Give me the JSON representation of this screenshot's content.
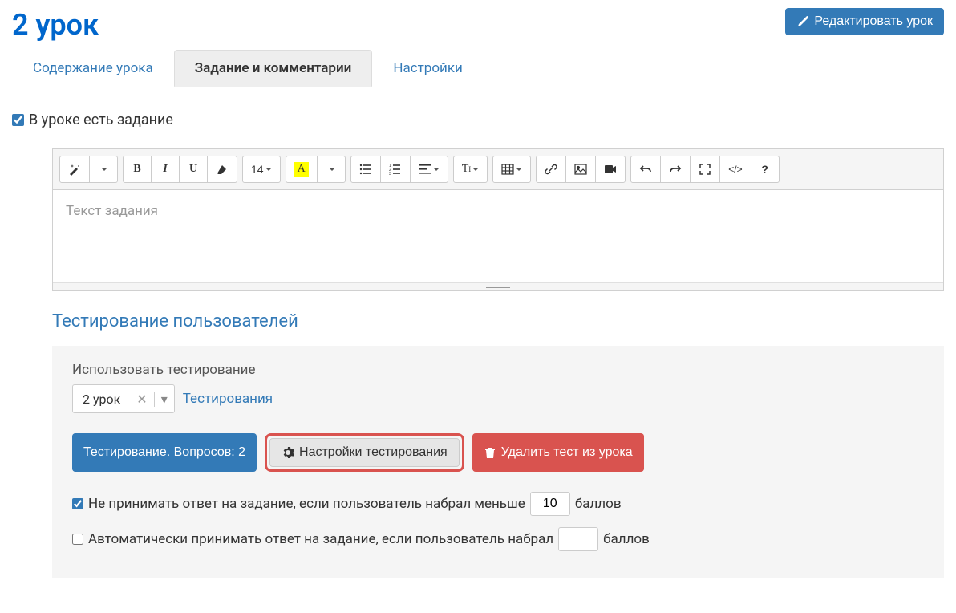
{
  "header": {
    "title": "2 урок",
    "edit_button": "Редактировать урок"
  },
  "tabs": [
    {
      "label": "Содержание урока",
      "active": false
    },
    {
      "label": "Задание и комментарии",
      "active": true
    },
    {
      "label": "Настройки",
      "active": false
    }
  ],
  "has_task_checkbox": {
    "label": "В уроке есть задание",
    "checked": true
  },
  "editor": {
    "placeholder": "Текст задания",
    "font_size": "14"
  },
  "testing": {
    "section_title": "Тестирование пользователей",
    "use_testing_label": "Использовать тестирование",
    "selected_test": "2 урок",
    "tests_link": "Тестирования",
    "buttons": {
      "info": "Тестирование. Вопросов: 2",
      "settings": "Настройки тестирования",
      "delete": "Удалить тест из урока"
    },
    "min_score": {
      "label_before": "Не принимать ответ на задание, если пользователь набрал меньше",
      "value": "10",
      "label_after": "баллов",
      "checked": true
    },
    "auto_accept": {
      "label_before": "Автоматически принимать ответ на задание, если пользователь набрал",
      "value": "",
      "label_after": "баллов",
      "checked": false
    }
  }
}
